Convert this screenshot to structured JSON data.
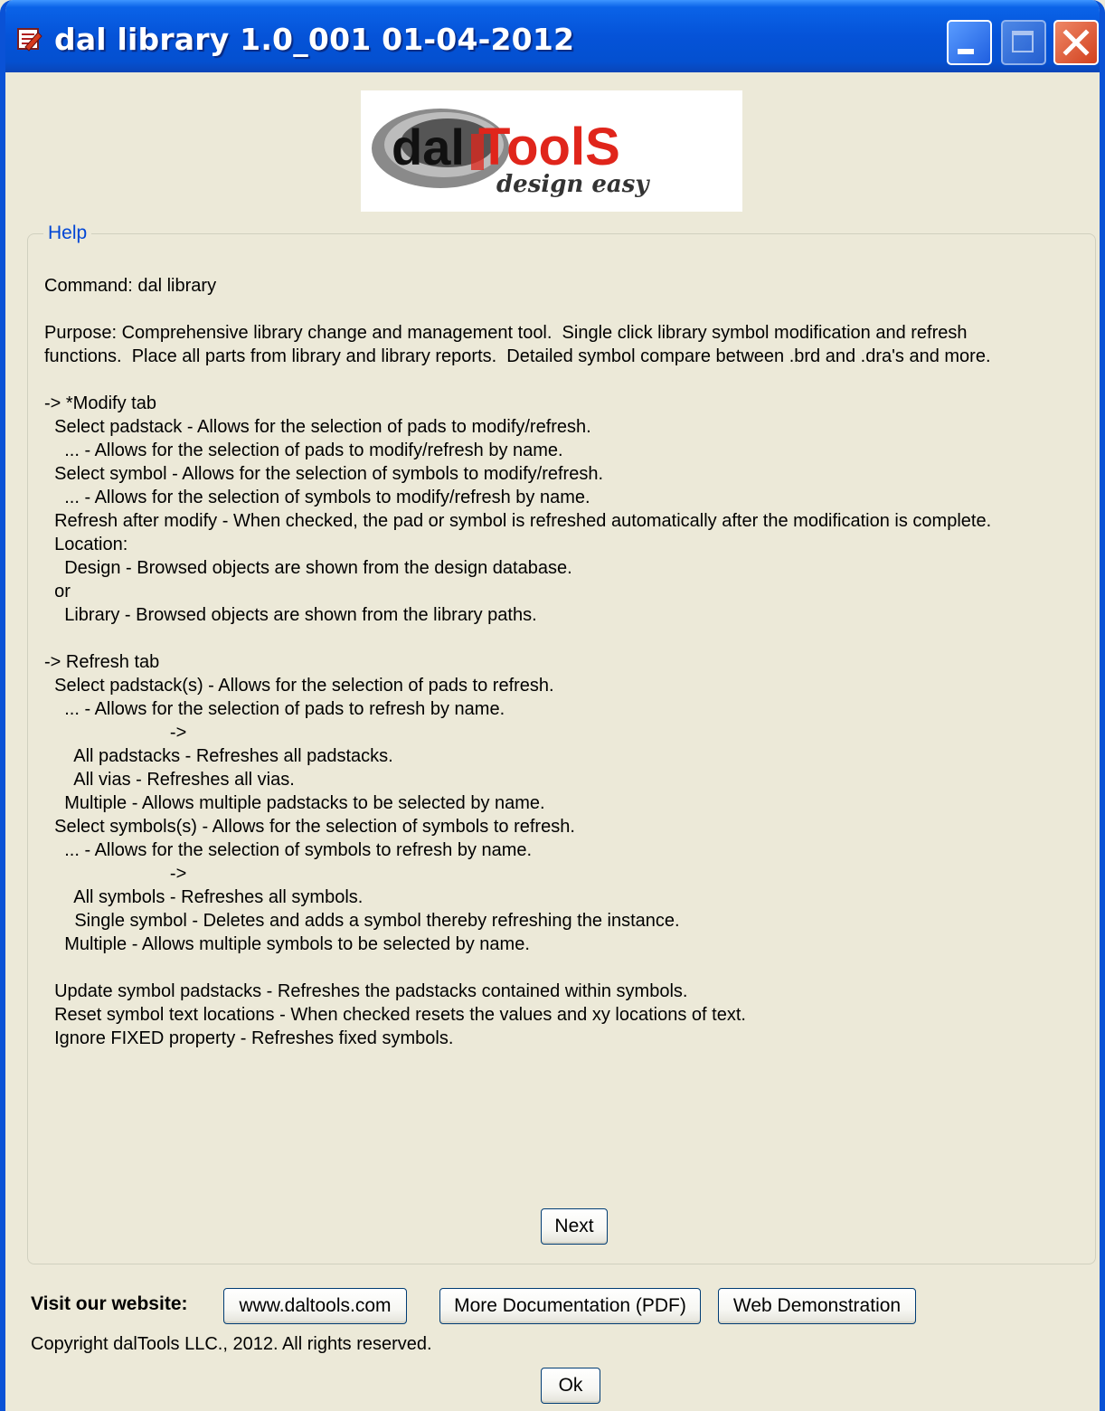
{
  "window": {
    "title": "dal library 1.0_001 01-04-2012"
  },
  "logo": {
    "brand_left": "dal",
    "brand_right": "ToolS",
    "tagline": "design easy"
  },
  "help": {
    "legend": "Help",
    "lines": [
      "Command: dal library",
      "",
      "Purpose: Comprehensive library change and management tool.  Single click library symbol modification and refresh",
      "functions.  Place all parts from library and library reports.  Detailed symbol compare between .brd and .dra's and more.",
      "",
      "-> *Modify tab",
      "  Select padstack - Allows for the selection of pads to modify/refresh.",
      "    ... - Allows for the selection of pads to modify/refresh by name.",
      "  Select symbol - Allows for the selection of symbols to modify/refresh.",
      "    ... - Allows for the selection of symbols to modify/refresh by name.",
      "  Refresh after modify - When checked, the pad or symbol is refreshed automatically after the modification is complete.",
      "  Location:",
      "    Design - Browsed objects are shown from the design database.",
      "  or",
      "    Library - Browsed objects are shown from the library paths.",
      "",
      "-> Refresh tab",
      "  Select padstack(s) - Allows for the selection of pads to refresh.",
      "    ... - Allows for the selection of pads to refresh by name.",
      "                         ->",
      "      All padstacks - Refreshes all padstacks.",
      "      All vias - Refreshes all vias.",
      "    Multiple - Allows multiple padstacks to be selected by name.",
      "  Select symbols(s) - Allows for the selection of symbols to refresh.",
      "    ... - Allows for the selection of symbols to refresh by name.",
      "                         ->",
      "      All symbols - Refreshes all symbols.",
      "      Single symbol - Deletes and adds a symbol thereby refreshing the instance.",
      "    Multiple - Allows multiple symbols to be selected by name.",
      "",
      "  Update symbol padstacks - Refreshes the padstacks contained within symbols.",
      "  Reset symbol text locations - When checked resets the values and xy locations of text.",
      "  Ignore FIXED property - Refreshes fixed symbols."
    ],
    "next_label": "Next"
  },
  "footer": {
    "visit_label": "Visit our website:",
    "website_button": "www.daltools.com",
    "docs_button": "More Documentation (PDF)",
    "demo_button": "Web Demonstration",
    "copyright": "Copyright dalTools LLC., 2012. All rights reserved.",
    "ok_label": "Ok"
  },
  "colors": {
    "titlebar": "#0553d8",
    "legend_text": "#0046d5",
    "dialog_bg": "#ece9d8",
    "logo_red": "#e0251b"
  },
  "icons": [
    "app-icon",
    "minimize-icon",
    "maximize-icon",
    "close-icon"
  ]
}
